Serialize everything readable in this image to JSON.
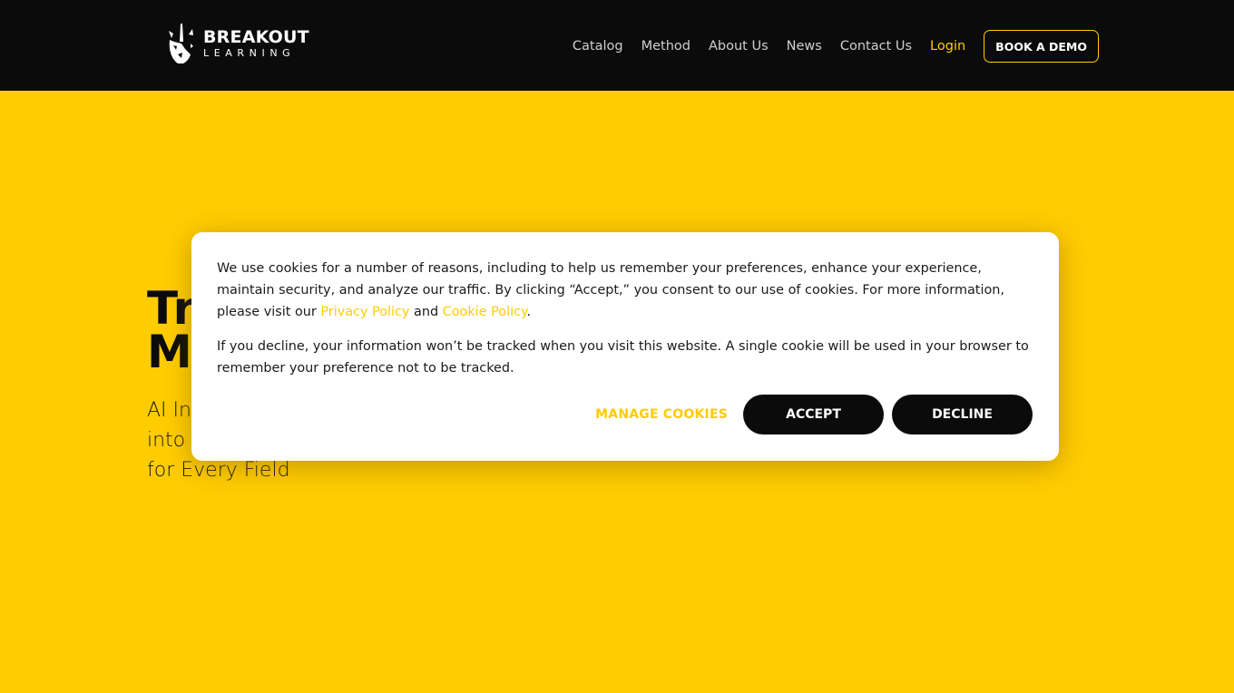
{
  "header": {
    "logo": {
      "icon": "rhino-head-icon",
      "line1": "BREAKOUT",
      "line2": "LEARNING"
    },
    "nav": [
      {
        "label": "Catalog"
      },
      {
        "label": "Method"
      },
      {
        "label": "About Us"
      },
      {
        "label": "News"
      },
      {
        "label": "Contact Us"
      },
      {
        "label": "Login"
      }
    ],
    "cta_label": "BOOK A DEMO"
  },
  "hero": {
    "title_line1": "Tr",
    "title_line2": "M",
    "subtitle_line1": "AI Ins",
    "subtitle_line2": "into",
    "subtitle_line3": "for Every Field"
  },
  "cookie_banner": {
    "para1_before": "We use cookies for a number of reasons, including to help us remember your preferences, enhance your experience, maintain security, and analyze our traffic. By clicking “Accept,” you consent to our use of cookies. For more information, please visit our ",
    "privacy_link": "Privacy Policy",
    "para1_mid": " and ",
    "cookie_link": "Cookie Policy",
    "para1_end": ".",
    "para2": "If you decline, your information won’t be tracked when you visit this website. A single cookie will be used in your browser to remember your preference not to be tracked.",
    "manage_label": "MANAGE COOKIES",
    "accept_label": "ACCEPT",
    "decline_label": "DECLINE"
  },
  "colors": {
    "brand_yellow": "#ffcc00",
    "header_bg": "#0b0b0b",
    "button_bg": "#0b0b0b"
  }
}
